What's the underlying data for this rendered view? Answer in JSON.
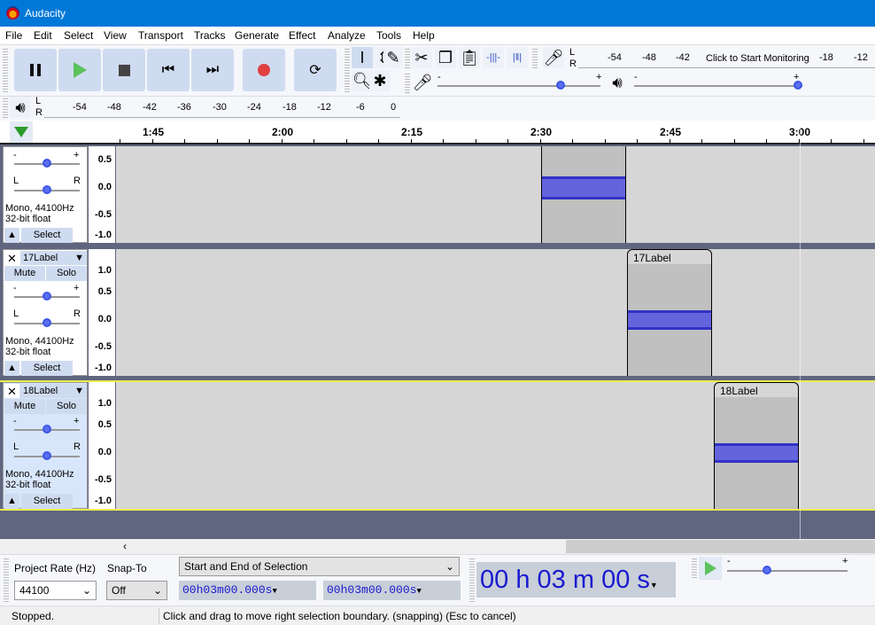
{
  "app": {
    "title": "Audacity"
  },
  "menu": [
    "File",
    "Edit",
    "Select",
    "View",
    "Transport",
    "Tracks",
    "Generate",
    "Effect",
    "Analyze",
    "Tools",
    "Help"
  ],
  "transport": {
    "buttons": [
      "pause",
      "play",
      "stop",
      "skip-start",
      "skip-end",
      "record",
      "loop"
    ]
  },
  "recording_meter": {
    "ticks": [
      "-54",
      "-48",
      "-42",
      "-18",
      "-12"
    ],
    "monitor_label": "Click to Start Monitoring",
    "channels": [
      "L",
      "R"
    ]
  },
  "playback_meter": {
    "ticks": [
      "-54",
      "-48",
      "-42",
      "-36",
      "-30",
      "-24",
      "-18",
      "-12",
      "-6",
      "0"
    ],
    "channels": [
      "L",
      "R"
    ]
  },
  "mixer": {
    "record_volume": 0.75,
    "playback_volume": 1.0,
    "minus": "-",
    "plus": "+"
  },
  "timeline": {
    "ticks": [
      "1:45",
      "2:00",
      "2:15",
      "2:30",
      "2:45",
      "3:00"
    ]
  },
  "tracks": [
    {
      "name": "",
      "info1": "Mono, 44100Hz",
      "info2": "32-bit float",
      "select": "Select",
      "scale": [
        "0.5",
        "0.0",
        "-0.5",
        "-1.0"
      ],
      "clip_label": "",
      "gain": 0.5,
      "pan": 0.5
    },
    {
      "name": "17Label",
      "mute": "Mute",
      "solo": "Solo",
      "info1": "Mono, 44100Hz",
      "info2": "32-bit float",
      "select": "Select",
      "scale": [
        "1.0",
        "0.5",
        "0.0",
        "-0.5",
        "-1.0"
      ],
      "clip_label": "17Label",
      "gain": 0.5,
      "pan": 0.5
    },
    {
      "name": "18Label",
      "mute": "Mute",
      "solo": "Solo",
      "info1": "Mono, 44100Hz",
      "info2": "32-bit float",
      "select": "Select",
      "scale": [
        "1.0",
        "0.5",
        "0.0",
        "-0.5",
        "-1.0"
      ],
      "clip_label": "18Label",
      "gain": 0.5,
      "pan": 0.5,
      "selected": true
    }
  ],
  "gain_labels": {
    "minus": "-",
    "plus": "+",
    "left": "L",
    "right": "R"
  },
  "selection": {
    "project_rate_label": "Project Rate (Hz)",
    "snap_to_label": "Snap-To",
    "project_rate": "44100",
    "snap_to": "Off",
    "mode": "Start and End of Selection",
    "start": [
      "00",
      "h",
      "03",
      "m",
      "00.000",
      "s"
    ],
    "end": [
      "00",
      "h",
      "03",
      "m",
      "00.000",
      "s"
    ]
  },
  "time_display": [
    "00",
    "h",
    "03",
    "m",
    "00",
    "s"
  ],
  "play_at_speed": {
    "minus": "-",
    "plus": "+",
    "speed": 0.3
  },
  "status": {
    "state": "Stopped.",
    "message": "Click and drag to move right selection boundary. (snapping) (Esc to cancel)"
  }
}
